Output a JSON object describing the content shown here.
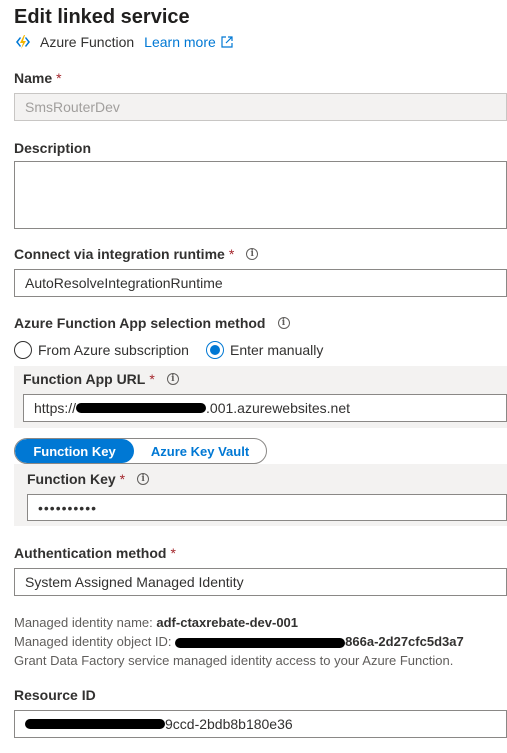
{
  "header": {
    "title": "Edit linked service",
    "service_type": "Azure Function",
    "learn_more": "Learn more"
  },
  "fields": {
    "name": {
      "label": "Name",
      "value": "SmsRouterDev"
    },
    "description": {
      "label": "Description",
      "value": ""
    },
    "runtime": {
      "label": "Connect via integration runtime",
      "value": "AutoResolveIntegrationRuntime"
    },
    "selection_method": {
      "label": "Azure Function App selection method",
      "options": [
        "From Azure subscription",
        "Enter manually"
      ],
      "selected": "Enter manually"
    },
    "function_app_url": {
      "label": "Function App URL",
      "prefix": "https://",
      "suffix": ".001.azurewebsites.net"
    },
    "key_source": {
      "tabs": [
        "Function Key",
        "Azure Key Vault"
      ],
      "selected": "Function Key"
    },
    "function_key": {
      "label": "Function Key",
      "value": "••••••••••"
    },
    "auth_method": {
      "label": "Authentication method",
      "value": "System Assigned Managed Identity"
    },
    "resource_id": {
      "label": "Resource ID",
      "suffix": "9ccd-2bdb8b180e36"
    }
  },
  "managed_identity": {
    "name_label": "Managed identity name:",
    "name_value": "adf-ctaxrebate-dev-001",
    "object_id_label": "Managed identity object ID:",
    "object_id_suffix": "866a-2d27cfc5d3a7",
    "grant_text": "Grant Data Factory service managed identity access to your Azure Function."
  },
  "colors": {
    "accent": "#0078d4",
    "required": "#a4262c"
  },
  "icons": {
    "service": "azure-function-bolt-icon",
    "external": "external-link-icon",
    "info": "info-icon"
  }
}
